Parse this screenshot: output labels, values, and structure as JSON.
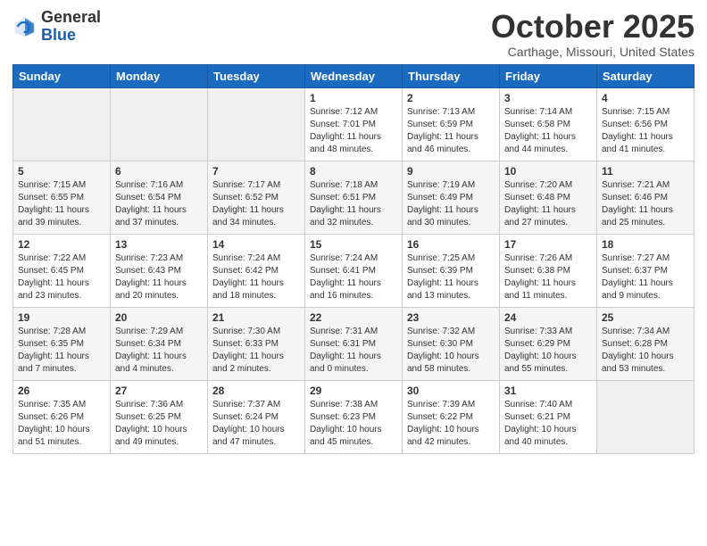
{
  "header": {
    "logo_general": "General",
    "logo_blue": "Blue",
    "month_title": "October 2025",
    "location": "Carthage, Missouri, United States"
  },
  "days_of_week": [
    "Sunday",
    "Monday",
    "Tuesday",
    "Wednesday",
    "Thursday",
    "Friday",
    "Saturday"
  ],
  "weeks": [
    [
      {
        "day": "",
        "info": ""
      },
      {
        "day": "",
        "info": ""
      },
      {
        "day": "",
        "info": ""
      },
      {
        "day": "1",
        "info": "Sunrise: 7:12 AM\nSunset: 7:01 PM\nDaylight: 11 hours\nand 48 minutes."
      },
      {
        "day": "2",
        "info": "Sunrise: 7:13 AM\nSunset: 6:59 PM\nDaylight: 11 hours\nand 46 minutes."
      },
      {
        "day": "3",
        "info": "Sunrise: 7:14 AM\nSunset: 6:58 PM\nDaylight: 11 hours\nand 44 minutes."
      },
      {
        "day": "4",
        "info": "Sunrise: 7:15 AM\nSunset: 6:56 PM\nDaylight: 11 hours\nand 41 minutes."
      }
    ],
    [
      {
        "day": "5",
        "info": "Sunrise: 7:15 AM\nSunset: 6:55 PM\nDaylight: 11 hours\nand 39 minutes."
      },
      {
        "day": "6",
        "info": "Sunrise: 7:16 AM\nSunset: 6:54 PM\nDaylight: 11 hours\nand 37 minutes."
      },
      {
        "day": "7",
        "info": "Sunrise: 7:17 AM\nSunset: 6:52 PM\nDaylight: 11 hours\nand 34 minutes."
      },
      {
        "day": "8",
        "info": "Sunrise: 7:18 AM\nSunset: 6:51 PM\nDaylight: 11 hours\nand 32 minutes."
      },
      {
        "day": "9",
        "info": "Sunrise: 7:19 AM\nSunset: 6:49 PM\nDaylight: 11 hours\nand 30 minutes."
      },
      {
        "day": "10",
        "info": "Sunrise: 7:20 AM\nSunset: 6:48 PM\nDaylight: 11 hours\nand 27 minutes."
      },
      {
        "day": "11",
        "info": "Sunrise: 7:21 AM\nSunset: 6:46 PM\nDaylight: 11 hours\nand 25 minutes."
      }
    ],
    [
      {
        "day": "12",
        "info": "Sunrise: 7:22 AM\nSunset: 6:45 PM\nDaylight: 11 hours\nand 23 minutes."
      },
      {
        "day": "13",
        "info": "Sunrise: 7:23 AM\nSunset: 6:43 PM\nDaylight: 11 hours\nand 20 minutes."
      },
      {
        "day": "14",
        "info": "Sunrise: 7:24 AM\nSunset: 6:42 PM\nDaylight: 11 hours\nand 18 minutes."
      },
      {
        "day": "15",
        "info": "Sunrise: 7:24 AM\nSunset: 6:41 PM\nDaylight: 11 hours\nand 16 minutes."
      },
      {
        "day": "16",
        "info": "Sunrise: 7:25 AM\nSunset: 6:39 PM\nDaylight: 11 hours\nand 13 minutes."
      },
      {
        "day": "17",
        "info": "Sunrise: 7:26 AM\nSunset: 6:38 PM\nDaylight: 11 hours\nand 11 minutes."
      },
      {
        "day": "18",
        "info": "Sunrise: 7:27 AM\nSunset: 6:37 PM\nDaylight: 11 hours\nand 9 minutes."
      }
    ],
    [
      {
        "day": "19",
        "info": "Sunrise: 7:28 AM\nSunset: 6:35 PM\nDaylight: 11 hours\nand 7 minutes."
      },
      {
        "day": "20",
        "info": "Sunrise: 7:29 AM\nSunset: 6:34 PM\nDaylight: 11 hours\nand 4 minutes."
      },
      {
        "day": "21",
        "info": "Sunrise: 7:30 AM\nSunset: 6:33 PM\nDaylight: 11 hours\nand 2 minutes."
      },
      {
        "day": "22",
        "info": "Sunrise: 7:31 AM\nSunset: 6:31 PM\nDaylight: 11 hours\nand 0 minutes."
      },
      {
        "day": "23",
        "info": "Sunrise: 7:32 AM\nSunset: 6:30 PM\nDaylight: 10 hours\nand 58 minutes."
      },
      {
        "day": "24",
        "info": "Sunrise: 7:33 AM\nSunset: 6:29 PM\nDaylight: 10 hours\nand 55 minutes."
      },
      {
        "day": "25",
        "info": "Sunrise: 7:34 AM\nSunset: 6:28 PM\nDaylight: 10 hours\nand 53 minutes."
      }
    ],
    [
      {
        "day": "26",
        "info": "Sunrise: 7:35 AM\nSunset: 6:26 PM\nDaylight: 10 hours\nand 51 minutes."
      },
      {
        "day": "27",
        "info": "Sunrise: 7:36 AM\nSunset: 6:25 PM\nDaylight: 10 hours\nand 49 minutes."
      },
      {
        "day": "28",
        "info": "Sunrise: 7:37 AM\nSunset: 6:24 PM\nDaylight: 10 hours\nand 47 minutes."
      },
      {
        "day": "29",
        "info": "Sunrise: 7:38 AM\nSunset: 6:23 PM\nDaylight: 10 hours\nand 45 minutes."
      },
      {
        "day": "30",
        "info": "Sunrise: 7:39 AM\nSunset: 6:22 PM\nDaylight: 10 hours\nand 42 minutes."
      },
      {
        "day": "31",
        "info": "Sunrise: 7:40 AM\nSunset: 6:21 PM\nDaylight: 10 hours\nand 40 minutes."
      },
      {
        "day": "",
        "info": ""
      }
    ]
  ]
}
